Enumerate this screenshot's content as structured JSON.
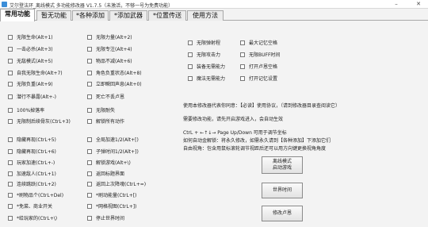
{
  "window": {
    "title": "艾尔登法环_离线模式 多功能修改器 V1.7.5（未激活，不够一号为免费功能）",
    "minimize_glyph": "–",
    "close_glyph": "✕"
  },
  "tabs": [
    {
      "label": "常用功能",
      "active": true
    },
    {
      "label": "暂无功能",
      "active": false
    },
    {
      "label": "*各种添加",
      "active": false
    },
    {
      "label": "*添加武器",
      "active": false
    },
    {
      "label": "*位置传送",
      "active": false
    },
    {
      "label": "使用方法",
      "active": false
    }
  ],
  "options": {
    "col1": [
      "无限生命(Alt+1)",
      "一击必杀(Alt+3)",
      "无敌模式(Alt+5)",
      "自我无限生命(Alt+7)",
      "无限负重(Alt+9)",
      "潜行不暴露(Alt+-)",
      "100%掉落率",
      "无限制后续骨灰(CtrL+3)",
      "隐藏再现(CtrL+5)",
      "隐藏再现(CtrL+6)",
      "玩家加速(CtrL+-)",
      "加速敌人(CtrL+1)",
      "连续跳跃(CtrL+2)",
      "*刷物品个(CtrL+Del)",
      "*免菜、商业开关",
      "*给玩家的(CtrL+\\)"
    ],
    "col2": [
      "无限力量(Alt+2)",
      "无限专注(Alt+4)",
      "物品不减(Alt+6)",
      "角色负重状态(Alt+8)",
      "立即瞬回声息(Alt+0)",
      "死亡不丢卢恩",
      "无限耐失",
      "解锁所有动作",
      "全局加速1/2(Alt+[)",
      "子弹时间1/2(Alt+])",
      "解锁游戏(Alt+\\)",
      "返回标题界面",
      "返回上次降魂(CtrL+=)",
      "*刷动能量(CtrL+[)",
      "*网格视图(CtrL+])",
      "停止世界时间"
    ],
    "col3": [
      "无限弹射程",
      "无限攻击力",
      "装备无需能力",
      "魔法无需能力"
    ],
    "col4": [
      "最大记忆空格",
      "无限BUFF时间",
      "打开卢恩空格",
      "打开记忆设置"
    ]
  },
  "notes": [
    "使用本修改器代表你同意：【必读】使用协议，（请到修改器目录查阅读它）",
    "需要修改功能，请先开启游戏进入，会自动生效",
    "CtrL + ←↑↓→ Page Up/Down 可用于调节坐标",
    "如何自动金解锁：将永久修改，如需永久请到【各种添加】下添加它们",
    "自由视角：包含用鼠标滚轮调节视距后还可以用方向键更换视角角度"
  ],
  "buttons": {
    "offline_mode": "离线模式\n启动游戏",
    "world_time": "世界时间",
    "edit_runes": "修改卢恩"
  }
}
